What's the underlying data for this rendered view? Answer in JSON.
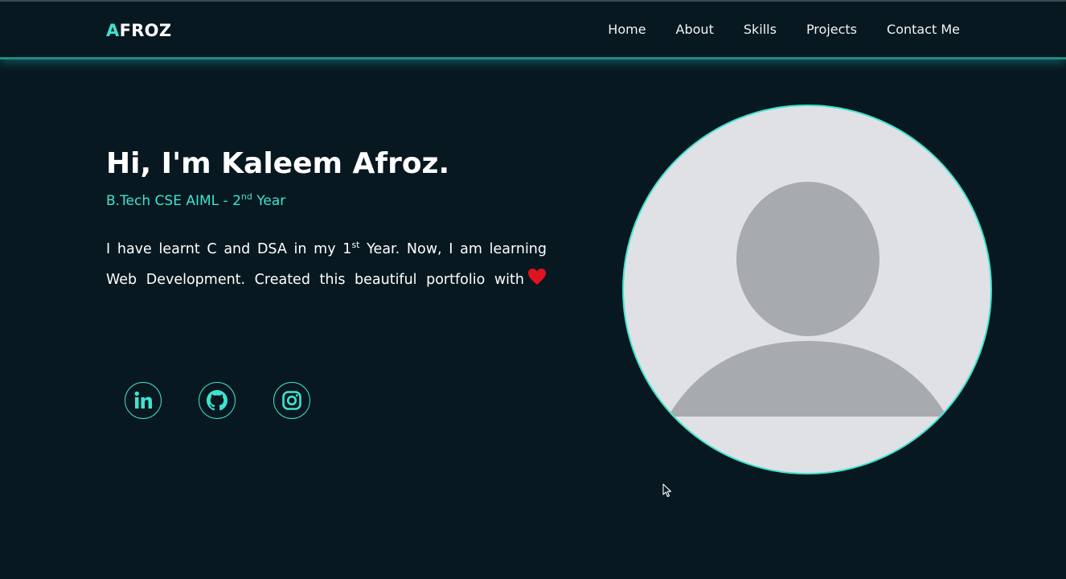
{
  "logo": {
    "first_letter": "A",
    "rest": "FROZ"
  },
  "nav": {
    "items": [
      {
        "label": "Home"
      },
      {
        "label": "About"
      },
      {
        "label": "Skills"
      },
      {
        "label": "Projects"
      },
      {
        "label": "Contact Me"
      }
    ]
  },
  "hero": {
    "title": "Hi, I'm Kaleem Afroz.",
    "subtitle_prefix": "B.Tech CSE AIML - 2",
    "subtitle_sup": "nd",
    "subtitle_suffix": " Year",
    "bio_part1": "I have learnt C and DSA in my 1",
    "bio_sup": "st",
    "bio_part2": " Year. Now, I am learning Web Development. Created this beautiful portfolio with",
    "heart_icon": "heart-icon"
  },
  "socials": [
    {
      "icon": "linkedin-icon"
    },
    {
      "icon": "github-icon"
    },
    {
      "icon": "instagram-icon"
    }
  ],
  "colors": {
    "background": "#081820",
    "accent": "#3fe3d0",
    "text": "#ffffff",
    "heart": "#e0141e",
    "avatar_bg": "#dfe1e5",
    "avatar_fg": "#a8abae"
  }
}
